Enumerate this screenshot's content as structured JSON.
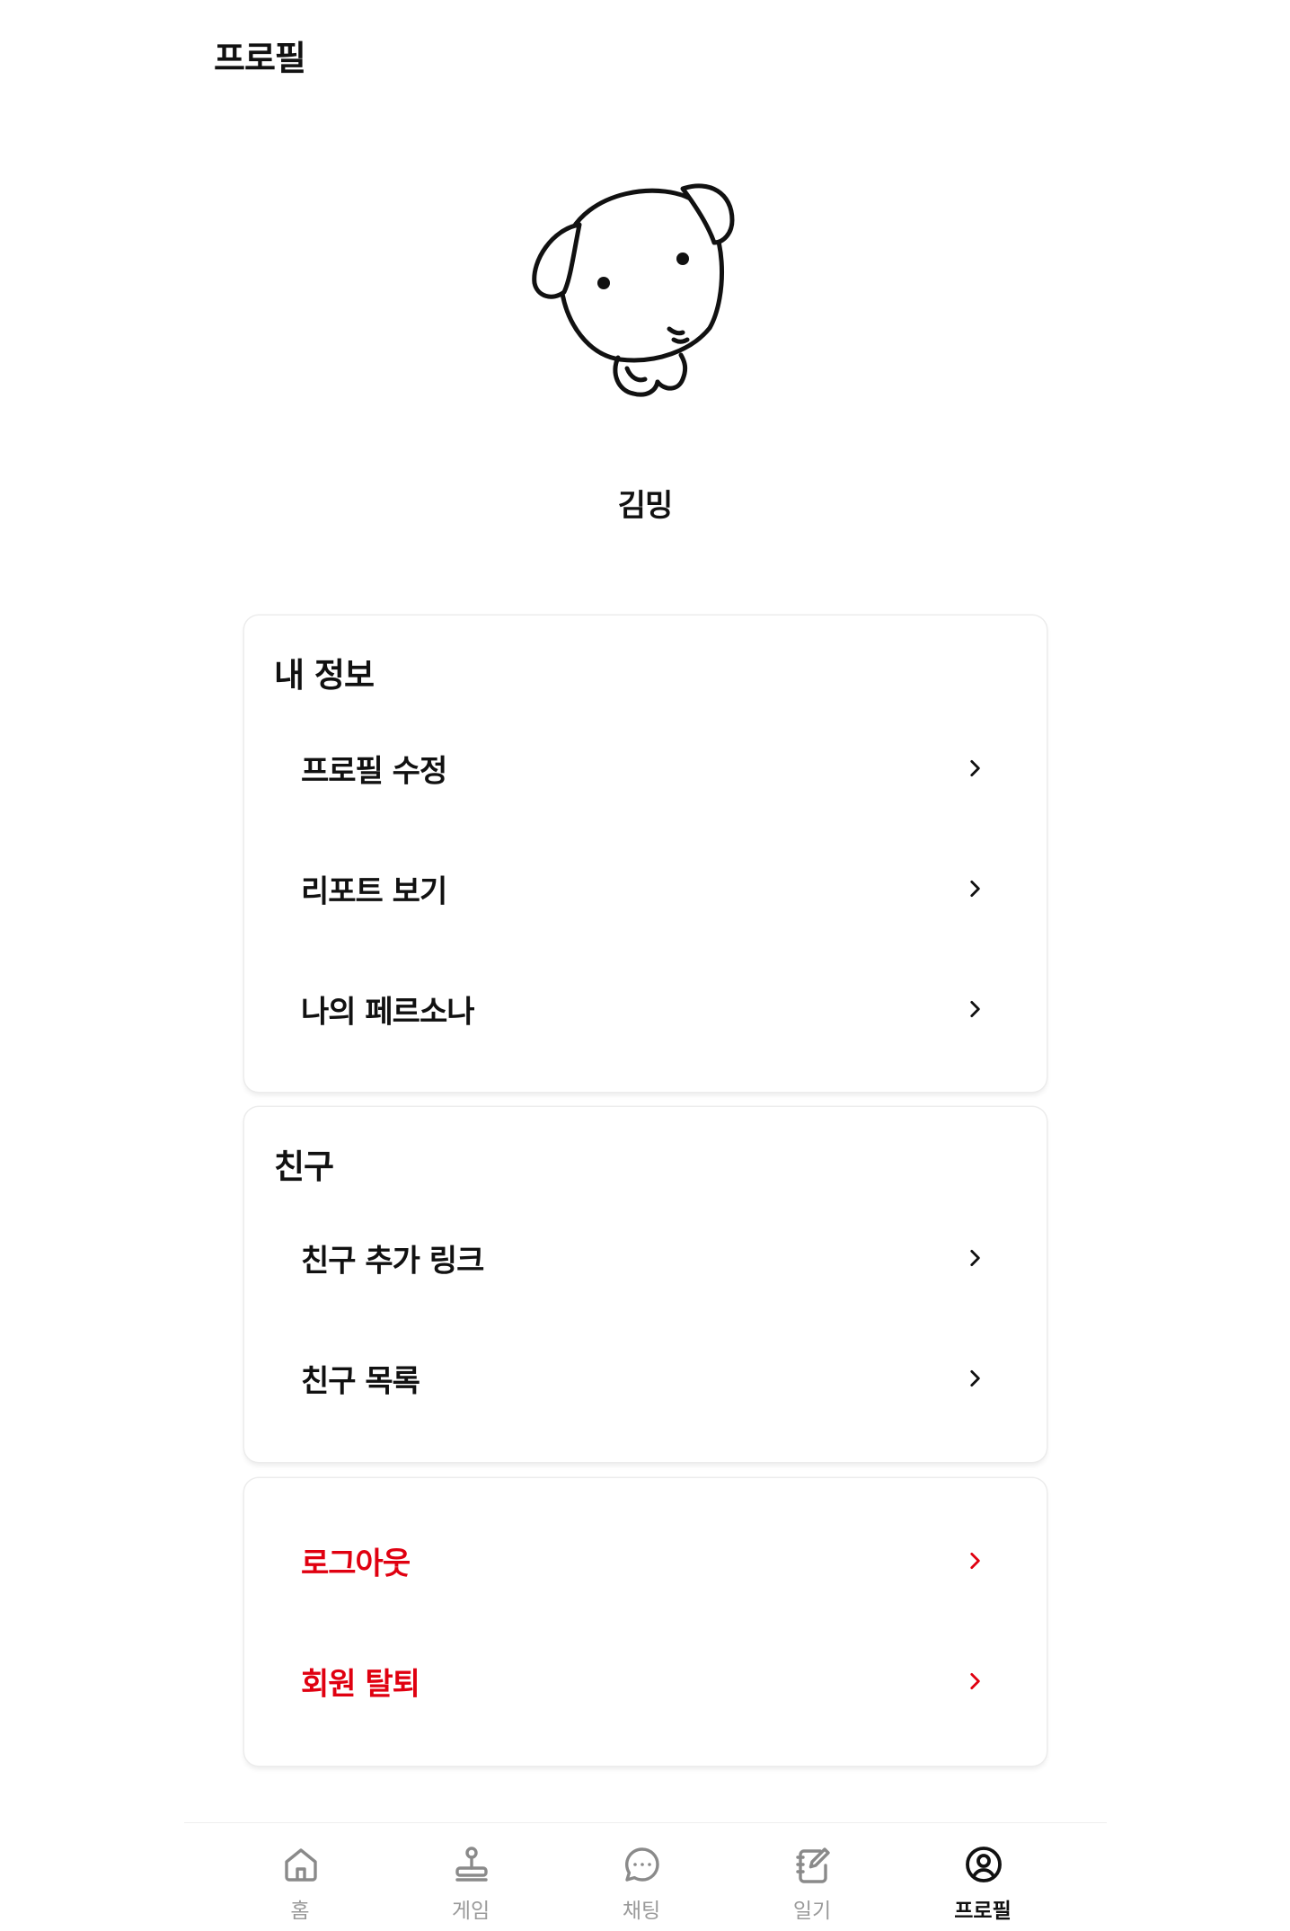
{
  "header": {
    "title": "프로필"
  },
  "profile": {
    "name": "김밍"
  },
  "sections": {
    "my_info": {
      "title": "내 정보",
      "items": [
        "프로필 수정",
        "리포트 보기",
        "나의 페르소나"
      ]
    },
    "friends": {
      "title": "친구",
      "items": [
        "친구 추가 링크",
        "친구 목록"
      ]
    },
    "account": {
      "items": [
        "로그아웃",
        "회원 탈퇴"
      ]
    }
  },
  "bottom_nav": [
    {
      "label": "홈",
      "icon": "home-icon"
    },
    {
      "label": "게임",
      "icon": "joystick-icon"
    },
    {
      "label": "채팅",
      "icon": "chat-icon"
    },
    {
      "label": "일기",
      "icon": "diary-icon"
    },
    {
      "label": "프로필",
      "icon": "profile-icon",
      "active": true
    }
  ],
  "colors": {
    "danger": "#e00010",
    "nav_inactive": "#9a9a9a",
    "text": "#111111"
  }
}
